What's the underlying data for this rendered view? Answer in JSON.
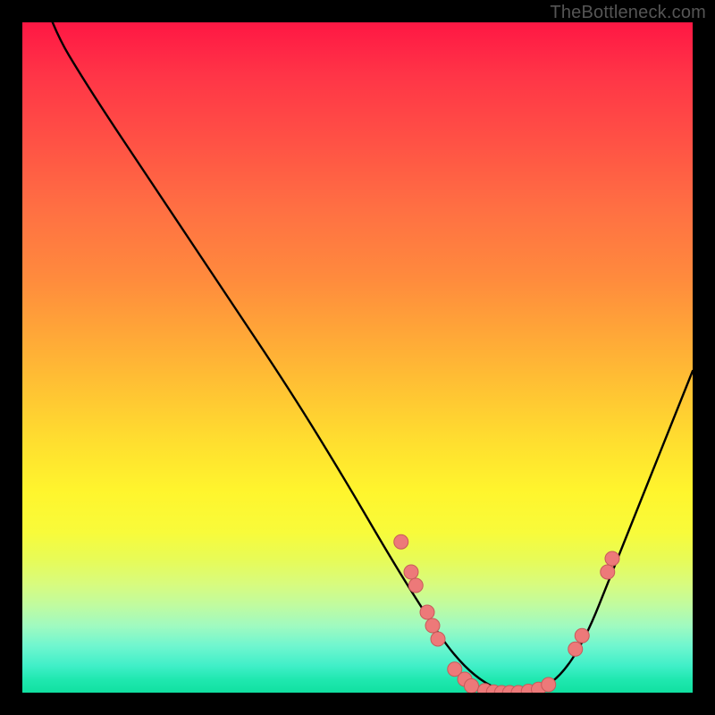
{
  "watermark": "TheBottleneck.com",
  "colors": {
    "curve": "#000000",
    "dot_fill": "#ed7979",
    "dot_stroke": "#c85a5a",
    "frame": "#000000"
  },
  "chart_data": {
    "type": "line",
    "title": "",
    "xlabel": "",
    "ylabel": "",
    "xlim": [
      0,
      100
    ],
    "ylim": [
      0,
      100
    ],
    "grid": false,
    "series": [
      {
        "name": "bottleneck-curve",
        "x": [
          0,
          4,
          10,
          20,
          30,
          40,
          48,
          55,
          60,
          64,
          68,
          72,
          76,
          80,
          84,
          88,
          92,
          96,
          100
        ],
        "y": [
          115,
          100,
          90,
          75,
          60,
          45,
          32,
          20,
          12,
          6,
          2,
          0,
          0,
          2,
          8,
          18,
          28,
          38,
          48
        ]
      }
    ],
    "points": [
      {
        "x": 56.5,
        "y": 22.5
      },
      {
        "x": 58.0,
        "y": 18.0
      },
      {
        "x": 58.7,
        "y": 16.0
      },
      {
        "x": 60.4,
        "y": 12.0
      },
      {
        "x": 61.2,
        "y": 10.0
      },
      {
        "x": 62.0,
        "y": 8.0
      },
      {
        "x": 64.5,
        "y": 3.5
      },
      {
        "x": 66.0,
        "y": 2.0
      },
      {
        "x": 67.0,
        "y": 1.0
      },
      {
        "x": 69.0,
        "y": 0.3
      },
      {
        "x": 70.3,
        "y": 0.1
      },
      {
        "x": 71.5,
        "y": 0.0
      },
      {
        "x": 72.7,
        "y": 0.0
      },
      {
        "x": 74.0,
        "y": 0.0
      },
      {
        "x": 75.5,
        "y": 0.2
      },
      {
        "x": 77.0,
        "y": 0.5
      },
      {
        "x": 78.5,
        "y": 1.2
      },
      {
        "x": 82.5,
        "y": 6.5
      },
      {
        "x": 83.5,
        "y": 8.5
      },
      {
        "x": 87.3,
        "y": 18.0
      },
      {
        "x": 88.0,
        "y": 20.0
      }
    ]
  }
}
